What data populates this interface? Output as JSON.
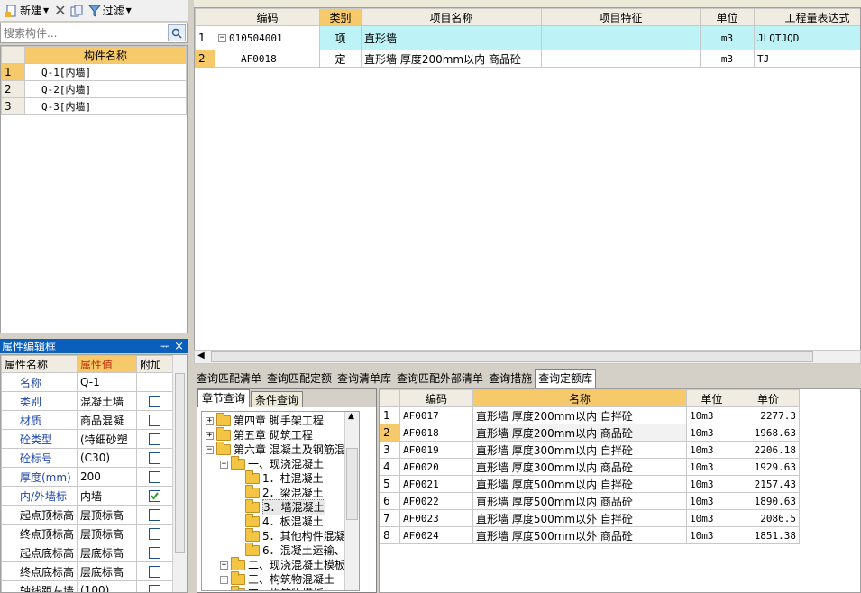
{
  "toolbar": {
    "new_label": "新建",
    "filter_label": "过滤"
  },
  "search": {
    "placeholder": "搜索构件..."
  },
  "components": {
    "header": "构件名称",
    "rows": [
      {
        "num": "1",
        "name": "Q-1[内墙]"
      },
      {
        "num": "2",
        "name": "Q-2[内墙]"
      },
      {
        "num": "3",
        "name": "Q-3[内墙]"
      }
    ]
  },
  "props": {
    "title": "属性编辑框",
    "pin": "ᅲ",
    "close": "×",
    "headers": [
      "属性名称",
      "属性值",
      "附加"
    ],
    "rows": [
      {
        "name": "名称",
        "value": "Q-1",
        "chk": null
      },
      {
        "name": "类别",
        "value": "混凝土墙",
        "chk": false
      },
      {
        "name": "材质",
        "value": "商品混凝",
        "chk": false
      },
      {
        "name": "砼类型",
        "value": "(特细砂塑",
        "chk": false
      },
      {
        "name": "砼标号",
        "value": "(C30)",
        "chk": false
      },
      {
        "name": "厚度(mm)",
        "value": "200",
        "chk": false
      },
      {
        "name": "内/外墙标",
        "value": "内墙",
        "chk": true
      },
      {
        "name": "起点顶标高",
        "value": "层顶标高",
        "chk": false
      },
      {
        "name": "终点顶标高",
        "value": "层顶标高",
        "chk": false
      },
      {
        "name": "起点底标高",
        "value": "层底标高",
        "chk": false
      },
      {
        "name": "终点底标高",
        "value": "层底标高",
        "chk": false
      },
      {
        "name": "轴线距左墙",
        "value": "(100)",
        "chk": false
      }
    ]
  },
  "main_grid": {
    "headers": [
      "编码",
      "类别",
      "项目名称",
      "项目特征",
      "单位",
      "工程量表达式"
    ],
    "rows": [
      {
        "num": "1",
        "code": "010504001",
        "type": "项",
        "name": "直形墙",
        "feature": "",
        "unit": "m3",
        "expr": "JLQTJQD"
      },
      {
        "num": "2",
        "code": "AF0018",
        "type": "定",
        "name": "直形墙 厚度200mm以内 商品砼",
        "feature": "",
        "unit": "m3",
        "expr": "TJ"
      }
    ]
  },
  "query_tabs": [
    "查询匹配清单",
    "查询匹配定额",
    "查询清单库",
    "查询匹配外部清单",
    "查询措施",
    "查询定额库"
  ],
  "sub_tabs": [
    "章节查询",
    "条件查询"
  ],
  "tree": [
    {
      "label": "第四章 脚手架工程",
      "level": 0,
      "exp": "+"
    },
    {
      "label": "第五章 砌筑工程",
      "level": 0,
      "exp": "+"
    },
    {
      "label": "第六章 混凝土及钢筋混凝",
      "level": 0,
      "exp": "−"
    },
    {
      "label": "一、现浇混凝土",
      "level": 1,
      "exp": "−"
    },
    {
      "label": "1．柱混凝土",
      "level": 2,
      "exp": ""
    },
    {
      "label": "2．梁混凝土",
      "level": 2,
      "exp": ""
    },
    {
      "label": "3．墙混凝土",
      "level": 2,
      "exp": ""
    },
    {
      "label": "4．板混凝土",
      "level": 2,
      "exp": ""
    },
    {
      "label": "5．其他构件混凝",
      "level": 2,
      "exp": ""
    },
    {
      "label": "6．混凝土运输、",
      "level": 2,
      "exp": ""
    },
    {
      "label": "二、现浇混凝土模板",
      "level": 1,
      "exp": "+"
    },
    {
      "label": "三、构筑物混凝土",
      "level": 1,
      "exp": "+"
    },
    {
      "label": "四、构筑物模板",
      "level": 1,
      "exp": "+"
    }
  ],
  "quota": {
    "headers": [
      "编码",
      "名称",
      "单位",
      "单价"
    ],
    "rows": [
      {
        "num": "1",
        "code": "AF0017",
        "name": "直形墙 厚度200mm以内 自拌砼",
        "unit": "10m3",
        "price": "2277.3"
      },
      {
        "num": "2",
        "code": "AF0018",
        "name": "直形墙 厚度200mm以内 商品砼",
        "unit": "10m3",
        "price": "1968.63"
      },
      {
        "num": "3",
        "code": "AF0019",
        "name": "直形墙 厚度300mm以内 自拌砼",
        "unit": "10m3",
        "price": "2206.18"
      },
      {
        "num": "4",
        "code": "AF0020",
        "name": "直形墙 厚度300mm以内 商品砼",
        "unit": "10m3",
        "price": "1929.63"
      },
      {
        "num": "5",
        "code": "AF0021",
        "name": "直形墙 厚度500mm以内 自拌砼",
        "unit": "10m3",
        "price": "2157.43"
      },
      {
        "num": "6",
        "code": "AF0022",
        "name": "直形墙 厚度500mm以内 商品砼",
        "unit": "10m3",
        "price": "1890.63"
      },
      {
        "num": "7",
        "code": "AF0023",
        "name": "直形墙 厚度500mm以外 自拌砼",
        "unit": "10m3",
        "price": "2086.5"
      },
      {
        "num": "8",
        "code": "AF0024",
        "name": "直形墙 厚度500mm以外 商品砼",
        "unit": "10m3",
        "price": "1851.38"
      }
    ]
  },
  "colors": {
    "selected_header": "#f6c96a",
    "highlight_row": "#bdf3f6",
    "title_bar": "#0a5fbd"
  }
}
